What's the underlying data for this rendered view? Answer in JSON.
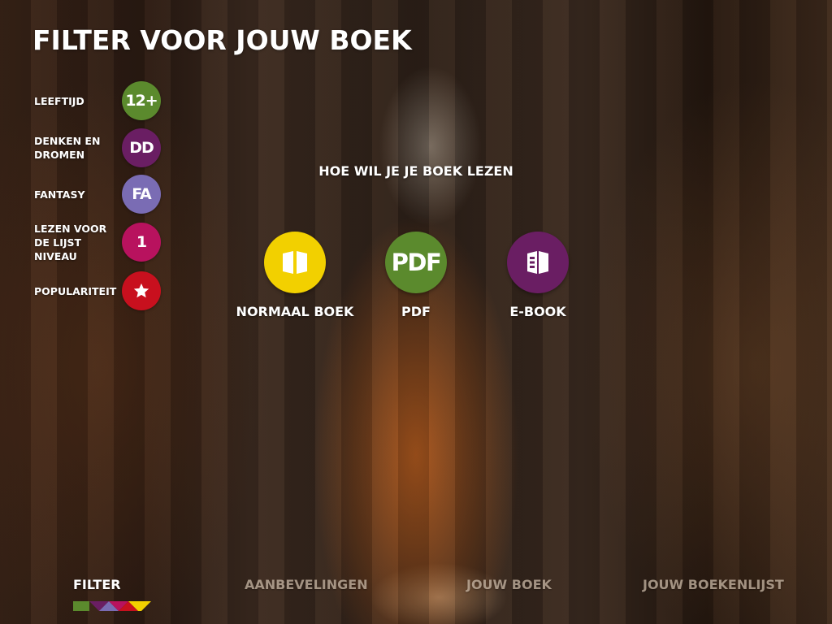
{
  "page": {
    "title": "FILTER VOOR JOUW BOEK"
  },
  "filters": [
    {
      "label": "LEEFTIJD",
      "badge": "12+",
      "color": "#5b8a2d"
    },
    {
      "label": "DENKEN EN DROMEN",
      "badge": "DD",
      "color": "#6a1e63"
    },
    {
      "label": "FANTASY",
      "badge": "FA",
      "color": "#7a6cb4"
    },
    {
      "label": "LEZEN VOOR DE LIJST NIVEAU",
      "badge": "1",
      "color": "#b8125e"
    },
    {
      "label": "POPULARITEIT",
      "badge_icon": "star-icon",
      "color": "#c8101e"
    }
  ],
  "question": "HOE WIL JE JE BOEK LEZEN",
  "options": [
    {
      "label": "NORMAAL BOEK",
      "icon": "open-book-icon",
      "color": "#f2d000"
    },
    {
      "label": "PDF",
      "icon_text": "PDF",
      "color": "#5b8a2d"
    },
    {
      "label": "E-BOOK",
      "icon": "ebook-icon",
      "color": "#6a1e63"
    }
  ],
  "nav": {
    "items": [
      "FILTER",
      "AANBEVELINGEN",
      "JOUW BOEK",
      "JOUW BOEKENLIJST"
    ],
    "active": "FILTER",
    "bar_colors": [
      "#5b8a2d",
      "#6a1e63",
      "#7a6cb4",
      "#b8125e",
      "#c8101e",
      "#f2d000"
    ]
  }
}
